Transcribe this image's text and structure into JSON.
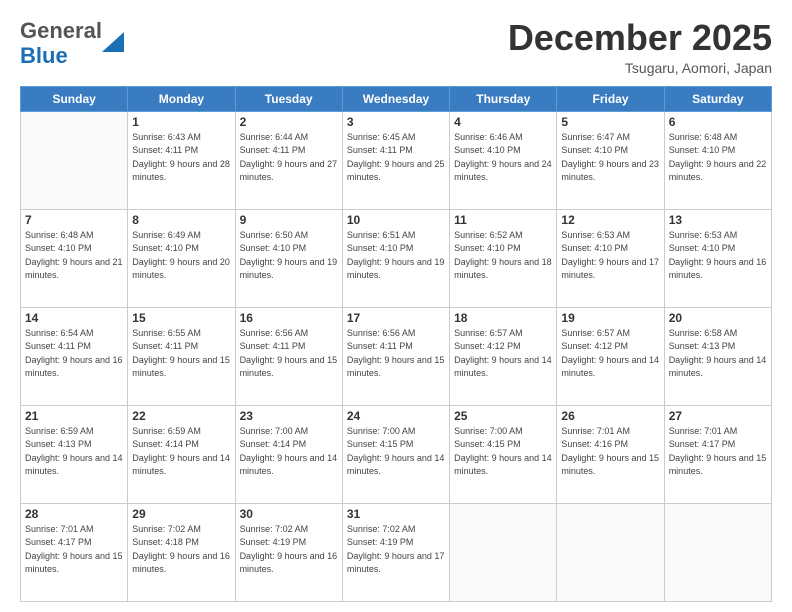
{
  "header": {
    "logo_line1": "General",
    "logo_line2": "Blue",
    "month": "December 2025",
    "location": "Tsugaru, Aomori, Japan"
  },
  "weekdays": [
    "Sunday",
    "Monday",
    "Tuesday",
    "Wednesday",
    "Thursday",
    "Friday",
    "Saturday"
  ],
  "weeks": [
    [
      {
        "day": "",
        "sunrise": "",
        "sunset": "",
        "daylight": ""
      },
      {
        "day": "1",
        "sunrise": "Sunrise: 6:43 AM",
        "sunset": "Sunset: 4:11 PM",
        "daylight": "Daylight: 9 hours and 28 minutes."
      },
      {
        "day": "2",
        "sunrise": "Sunrise: 6:44 AM",
        "sunset": "Sunset: 4:11 PM",
        "daylight": "Daylight: 9 hours and 27 minutes."
      },
      {
        "day": "3",
        "sunrise": "Sunrise: 6:45 AM",
        "sunset": "Sunset: 4:11 PM",
        "daylight": "Daylight: 9 hours and 25 minutes."
      },
      {
        "day": "4",
        "sunrise": "Sunrise: 6:46 AM",
        "sunset": "Sunset: 4:10 PM",
        "daylight": "Daylight: 9 hours and 24 minutes."
      },
      {
        "day": "5",
        "sunrise": "Sunrise: 6:47 AM",
        "sunset": "Sunset: 4:10 PM",
        "daylight": "Daylight: 9 hours and 23 minutes."
      },
      {
        "day": "6",
        "sunrise": "Sunrise: 6:48 AM",
        "sunset": "Sunset: 4:10 PM",
        "daylight": "Daylight: 9 hours and 22 minutes."
      }
    ],
    [
      {
        "day": "7",
        "sunrise": "Sunrise: 6:48 AM",
        "sunset": "Sunset: 4:10 PM",
        "daylight": "Daylight: 9 hours and 21 minutes."
      },
      {
        "day": "8",
        "sunrise": "Sunrise: 6:49 AM",
        "sunset": "Sunset: 4:10 PM",
        "daylight": "Daylight: 9 hours and 20 minutes."
      },
      {
        "day": "9",
        "sunrise": "Sunrise: 6:50 AM",
        "sunset": "Sunset: 4:10 PM",
        "daylight": "Daylight: 9 hours and 19 minutes."
      },
      {
        "day": "10",
        "sunrise": "Sunrise: 6:51 AM",
        "sunset": "Sunset: 4:10 PM",
        "daylight": "Daylight: 9 hours and 19 minutes."
      },
      {
        "day": "11",
        "sunrise": "Sunrise: 6:52 AM",
        "sunset": "Sunset: 4:10 PM",
        "daylight": "Daylight: 9 hours and 18 minutes."
      },
      {
        "day": "12",
        "sunrise": "Sunrise: 6:53 AM",
        "sunset": "Sunset: 4:10 PM",
        "daylight": "Daylight: 9 hours and 17 minutes."
      },
      {
        "day": "13",
        "sunrise": "Sunrise: 6:53 AM",
        "sunset": "Sunset: 4:10 PM",
        "daylight": "Daylight: 9 hours and 16 minutes."
      }
    ],
    [
      {
        "day": "14",
        "sunrise": "Sunrise: 6:54 AM",
        "sunset": "Sunset: 4:11 PM",
        "daylight": "Daylight: 9 hours and 16 minutes."
      },
      {
        "day": "15",
        "sunrise": "Sunrise: 6:55 AM",
        "sunset": "Sunset: 4:11 PM",
        "daylight": "Daylight: 9 hours and 15 minutes."
      },
      {
        "day": "16",
        "sunrise": "Sunrise: 6:56 AM",
        "sunset": "Sunset: 4:11 PM",
        "daylight": "Daylight: 9 hours and 15 minutes."
      },
      {
        "day": "17",
        "sunrise": "Sunrise: 6:56 AM",
        "sunset": "Sunset: 4:11 PM",
        "daylight": "Daylight: 9 hours and 15 minutes."
      },
      {
        "day": "18",
        "sunrise": "Sunrise: 6:57 AM",
        "sunset": "Sunset: 4:12 PM",
        "daylight": "Daylight: 9 hours and 14 minutes."
      },
      {
        "day": "19",
        "sunrise": "Sunrise: 6:57 AM",
        "sunset": "Sunset: 4:12 PM",
        "daylight": "Daylight: 9 hours and 14 minutes."
      },
      {
        "day": "20",
        "sunrise": "Sunrise: 6:58 AM",
        "sunset": "Sunset: 4:13 PM",
        "daylight": "Daylight: 9 hours and 14 minutes."
      }
    ],
    [
      {
        "day": "21",
        "sunrise": "Sunrise: 6:59 AM",
        "sunset": "Sunset: 4:13 PM",
        "daylight": "Daylight: 9 hours and 14 minutes."
      },
      {
        "day": "22",
        "sunrise": "Sunrise: 6:59 AM",
        "sunset": "Sunset: 4:14 PM",
        "daylight": "Daylight: 9 hours and 14 minutes."
      },
      {
        "day": "23",
        "sunrise": "Sunrise: 7:00 AM",
        "sunset": "Sunset: 4:14 PM",
        "daylight": "Daylight: 9 hours and 14 minutes."
      },
      {
        "day": "24",
        "sunrise": "Sunrise: 7:00 AM",
        "sunset": "Sunset: 4:15 PM",
        "daylight": "Daylight: 9 hours and 14 minutes."
      },
      {
        "day": "25",
        "sunrise": "Sunrise: 7:00 AM",
        "sunset": "Sunset: 4:15 PM",
        "daylight": "Daylight: 9 hours and 14 minutes."
      },
      {
        "day": "26",
        "sunrise": "Sunrise: 7:01 AM",
        "sunset": "Sunset: 4:16 PM",
        "daylight": "Daylight: 9 hours and 15 minutes."
      },
      {
        "day": "27",
        "sunrise": "Sunrise: 7:01 AM",
        "sunset": "Sunset: 4:17 PM",
        "daylight": "Daylight: 9 hours and 15 minutes."
      }
    ],
    [
      {
        "day": "28",
        "sunrise": "Sunrise: 7:01 AM",
        "sunset": "Sunset: 4:17 PM",
        "daylight": "Daylight: 9 hours and 15 minutes."
      },
      {
        "day": "29",
        "sunrise": "Sunrise: 7:02 AM",
        "sunset": "Sunset: 4:18 PM",
        "daylight": "Daylight: 9 hours and 16 minutes."
      },
      {
        "day": "30",
        "sunrise": "Sunrise: 7:02 AM",
        "sunset": "Sunset: 4:19 PM",
        "daylight": "Daylight: 9 hours and 16 minutes."
      },
      {
        "day": "31",
        "sunrise": "Sunrise: 7:02 AM",
        "sunset": "Sunset: 4:19 PM",
        "daylight": "Daylight: 9 hours and 17 minutes."
      },
      {
        "day": "",
        "sunrise": "",
        "sunset": "",
        "daylight": ""
      },
      {
        "day": "",
        "sunrise": "",
        "sunset": "",
        "daylight": ""
      },
      {
        "day": "",
        "sunrise": "",
        "sunset": "",
        "daylight": ""
      }
    ]
  ]
}
